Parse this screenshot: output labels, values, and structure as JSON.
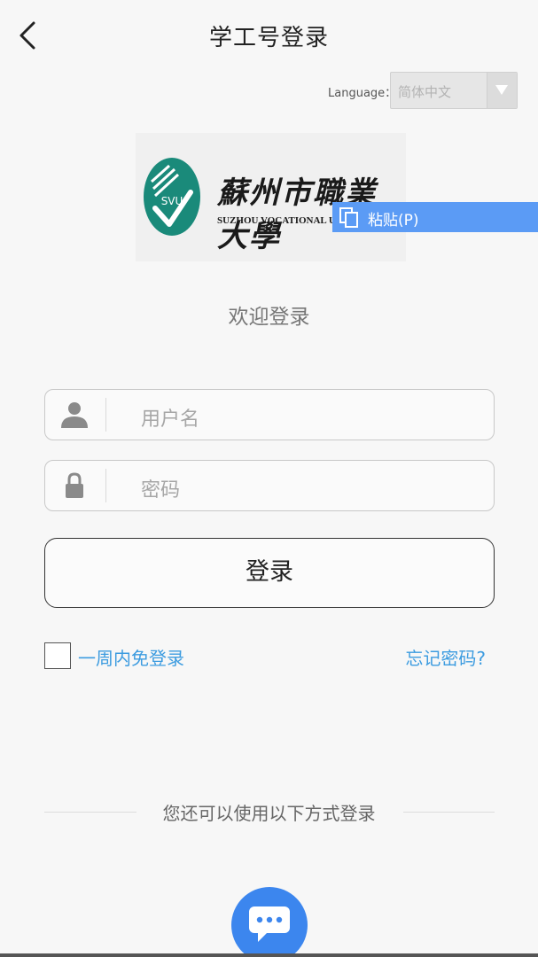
{
  "header": {
    "title": "学工号登录",
    "back_icon": "chevron-left-icon"
  },
  "language": {
    "label": "Language：",
    "selected": "简体中文"
  },
  "logo": {
    "cn_name": "蘇州市職業大學",
    "en_name": "SUZHOU VOCATIONAL UNIVERSITY",
    "emblem_text": "SVU",
    "emblem_color": "#1a8a7a"
  },
  "paste_menu": {
    "label": "粘贴(P)"
  },
  "welcome": "欢迎登录",
  "form": {
    "username_placeholder": "用户名",
    "password_placeholder": "密码",
    "login_button": "登录",
    "remember_label": "一周内免登录",
    "forgot_link": "忘记密码?"
  },
  "alt_login": {
    "text": "您还可以使用以下方式登录",
    "icon": "chat-bubble-icon",
    "accent": "#3c86ee"
  },
  "colors": {
    "link": "#3d9ce0",
    "paste_bg": "#5b9bf5"
  }
}
